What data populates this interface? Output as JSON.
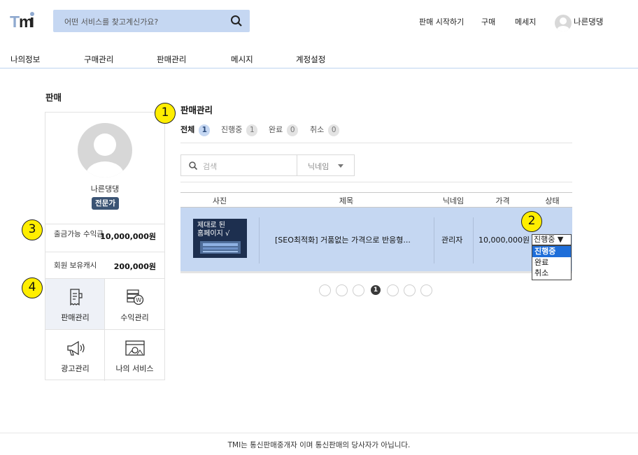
{
  "header": {
    "logo_text": "TMI",
    "search_placeholder": "어떤 서비스를 찾고계신가요?",
    "nav": [
      "판매 시작하기",
      "구매",
      "메세지"
    ],
    "username": "나른댕댕"
  },
  "menu": [
    "나의정보",
    "구매관리",
    "판매관리",
    "메시지",
    "계정설정"
  ],
  "left": {
    "section_title": "판매",
    "profile_name": "나른댕댕",
    "badge": "전문가",
    "withdrawable_label": "출금가능 수익금",
    "withdrawable_value": "10,000,000원",
    "cash_label": "회원 보유캐시",
    "cash_value": "200,000원",
    "grid": [
      {
        "label": "판매관리",
        "icon": "receipt-icon"
      },
      {
        "label": "수익관리",
        "icon": "won-coin-icon"
      },
      {
        "label": "광고관리",
        "icon": "megaphone-icon"
      },
      {
        "label": "나의 서비스",
        "icon": "service-window-icon"
      }
    ]
  },
  "main": {
    "title": "판매관리",
    "tabs": [
      {
        "label": "전체",
        "count": "1"
      },
      {
        "label": "진행중",
        "count": "1"
      },
      {
        "label": "완료",
        "count": "0"
      },
      {
        "label": "취소",
        "count": "0"
      }
    ],
    "search_placeholder": "검색",
    "filter_label": "닉네임",
    "columns": [
      "사진",
      "제목",
      "닉네임",
      "가격",
      "상태"
    ],
    "row": {
      "thumb_text_1": "제대로 된",
      "thumb_text_2": "홈페이지 √",
      "title": "[SEO최적화] 거품없는 가격으로 반응형...",
      "nickname": "관리자",
      "price": "10,000,000원",
      "status": "진행중 ▼"
    },
    "status_options": [
      "진행중",
      "완료",
      "취소"
    ],
    "pages": [
      "",
      "",
      "",
      "1",
      "",
      "",
      ""
    ]
  },
  "annotations": [
    "1",
    "2",
    "3",
    "4"
  ],
  "footer": "TMI는 통신판매중개자 이며 통신판매의 당사자가 아닙니다.",
  "colors": {
    "accent": "#c5d7f2",
    "badge": "#3b5474",
    "annotation": "#ffee00",
    "selected_option": "#1e6ed9"
  }
}
